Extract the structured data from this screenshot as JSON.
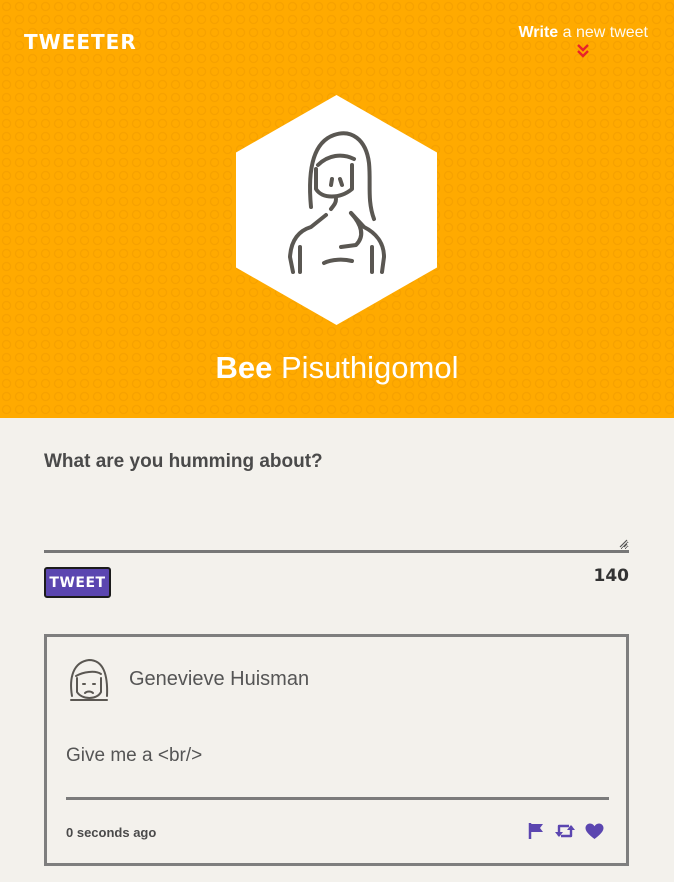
{
  "brand": {
    "logo_text": "TWEETER"
  },
  "nav": {
    "compose_strong": "Write",
    "compose_rest": " a new tweet"
  },
  "profile": {
    "first_name": "Bee",
    "last_name": " Pisuthigomol"
  },
  "composer": {
    "prompt": "What are you humming about?",
    "text_value": "",
    "button_label": "TWEET",
    "char_counter": "140"
  },
  "tweet": {
    "author": "Genevieve Huisman",
    "body": "Give me a <br/>",
    "timestamp": "0 seconds ago",
    "actions": [
      "flag-icon",
      "retweet-icon",
      "heart-icon"
    ]
  },
  "colors": {
    "header_bg": "#ffaa00",
    "page_bg": "#f3f1ec",
    "accent_purple": "#5b46b0",
    "chevron_red": "#e8232a"
  }
}
